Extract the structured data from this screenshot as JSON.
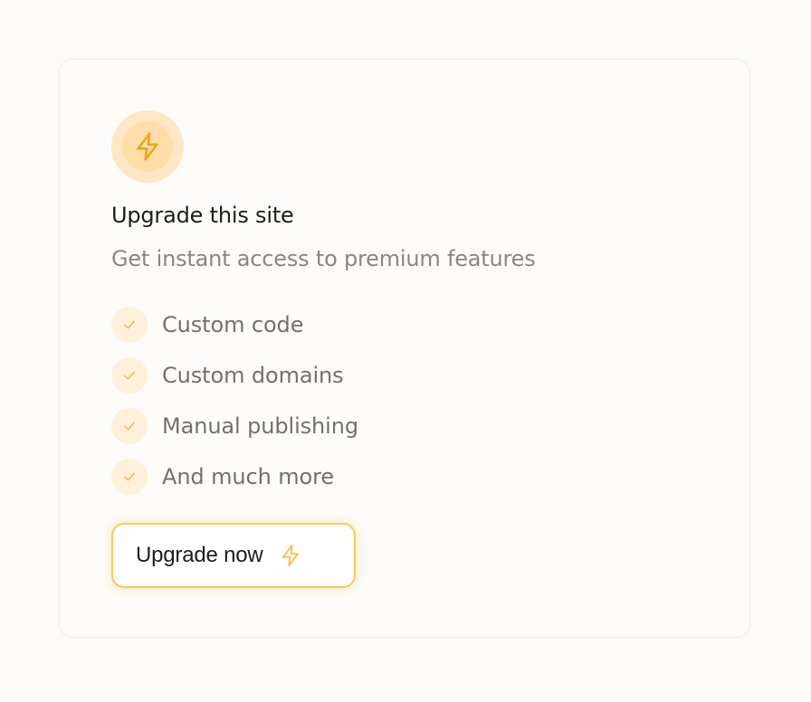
{
  "colors": {
    "accent": "#fbb02b",
    "icon_bg_outer": "#fee7c4",
    "icon_bg_inner": "#ffdda9",
    "check_bg": "#fff0da",
    "button_border": "#fcc75a"
  },
  "upgrade_card": {
    "icon": "lightning-bolt-icon",
    "title": "Upgrade this site",
    "subtitle": "Get instant access to premium features",
    "features": [
      {
        "icon": "check-icon",
        "label": "Custom code"
      },
      {
        "icon": "check-icon",
        "label": "Custom domains"
      },
      {
        "icon": "check-icon",
        "label": "Manual publishing"
      },
      {
        "icon": "check-icon",
        "label": "And much more"
      }
    ],
    "button": {
      "label": "Upgrade now",
      "icon": "lightning-bolt-icon"
    }
  }
}
